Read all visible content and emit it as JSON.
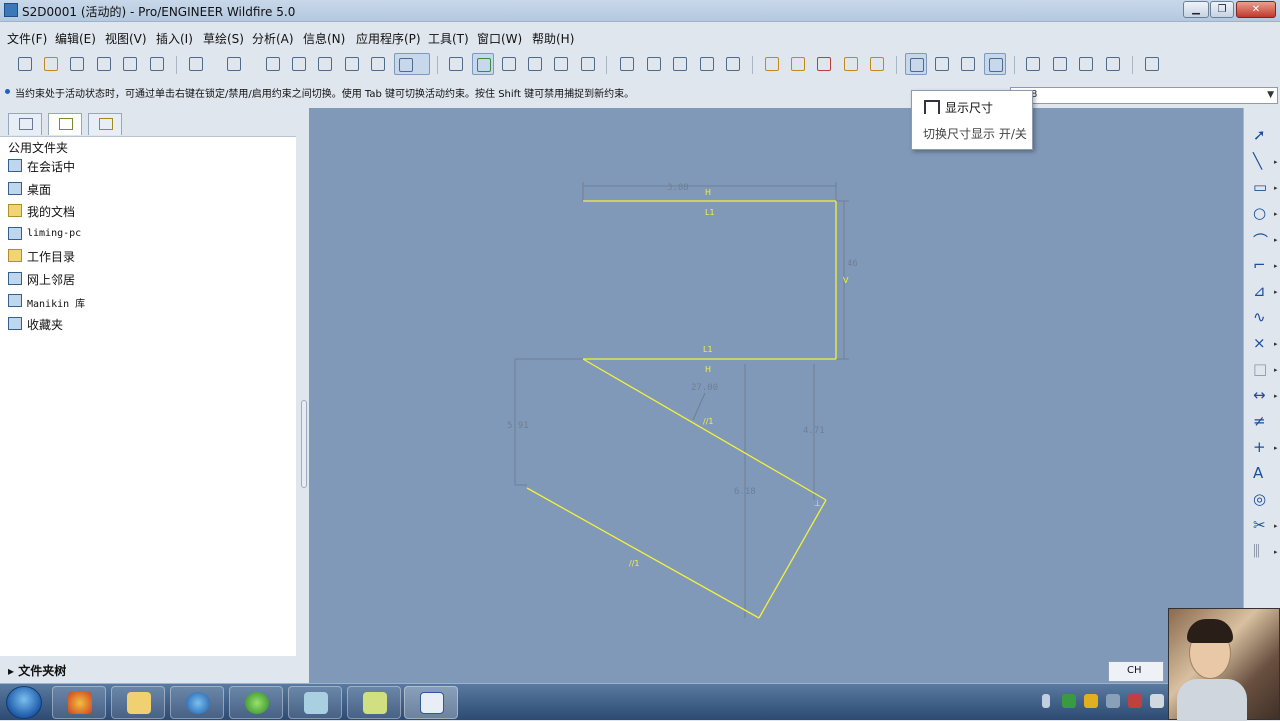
{
  "window": {
    "title": "S2D0001 (活动的) - Pro/ENGINEER Wildfire 5.0",
    "min_label": "▁",
    "max_label": "❐",
    "close_label": "✕"
  },
  "menu": [
    "文件(F)",
    "编辑(E)",
    "视图(V)",
    "插入(I)",
    "草绘(S)",
    "分析(A)",
    "信息(N)",
    "应用程序(P)",
    "工具(T)",
    "窗口(W)",
    "帮助(H)"
  ],
  "message": "当约束处于活动状态时，可通过单击右键在锁定/禁用/启用约束之间切换。使用 Tab 键可切换活动约束。按住 Shift 键可禁用捕捉到新约束。",
  "filter": {
    "value": "8"
  },
  "tooltip": {
    "title": "显示尺寸",
    "desc": "切换尺寸显示 开/关"
  },
  "navigator": {
    "header": "公用文件夹",
    "items": [
      {
        "label": "在会话中",
        "icon": "session-icon",
        "kind": "pc"
      },
      {
        "label": "桌面",
        "icon": "desktop-icon",
        "kind": "pc"
      },
      {
        "label": "我的文档",
        "icon": "documents-folder-icon",
        "kind": "folder"
      },
      {
        "label": "liming-pc",
        "icon": "computer-icon",
        "kind": "pc",
        "mono": true
      },
      {
        "label": "工作目录",
        "icon": "working-directory-icon",
        "kind": "folder"
      },
      {
        "label": "网上邻居",
        "icon": "network-icon",
        "kind": "pc"
      },
      {
        "label": "Manikin 库",
        "icon": "manikin-library-icon",
        "kind": "pc",
        "mono": true
      },
      {
        "label": "收藏夹",
        "icon": "favorites-icon",
        "kind": "pc"
      }
    ],
    "folder_tree": "▸ 文件夹树"
  },
  "sketch": {
    "line_color": "#f2f23a",
    "dim_color": "#6e7f96",
    "dims": {
      "top_width": "3.88",
      "right_height": "46",
      "angle": "27.00",
      "left_height": "5.91",
      "mid_height": "6.18",
      "right_vertical": "4.71"
    },
    "constraints": {
      "h": "H",
      "v": "V",
      "l1": "L1",
      "parallel": "//1",
      "perp": "⊥"
    }
  },
  "taskbar": {
    "lang": "CH",
    "apps": [
      "explorer-icon",
      "ie-icon",
      "tool-icon",
      "viewer-icon",
      "notes-icon",
      "proe-icon"
    ]
  },
  "colors": {
    "canvas": "#8199b8",
    "sketch_line": "#f2f23a"
  }
}
